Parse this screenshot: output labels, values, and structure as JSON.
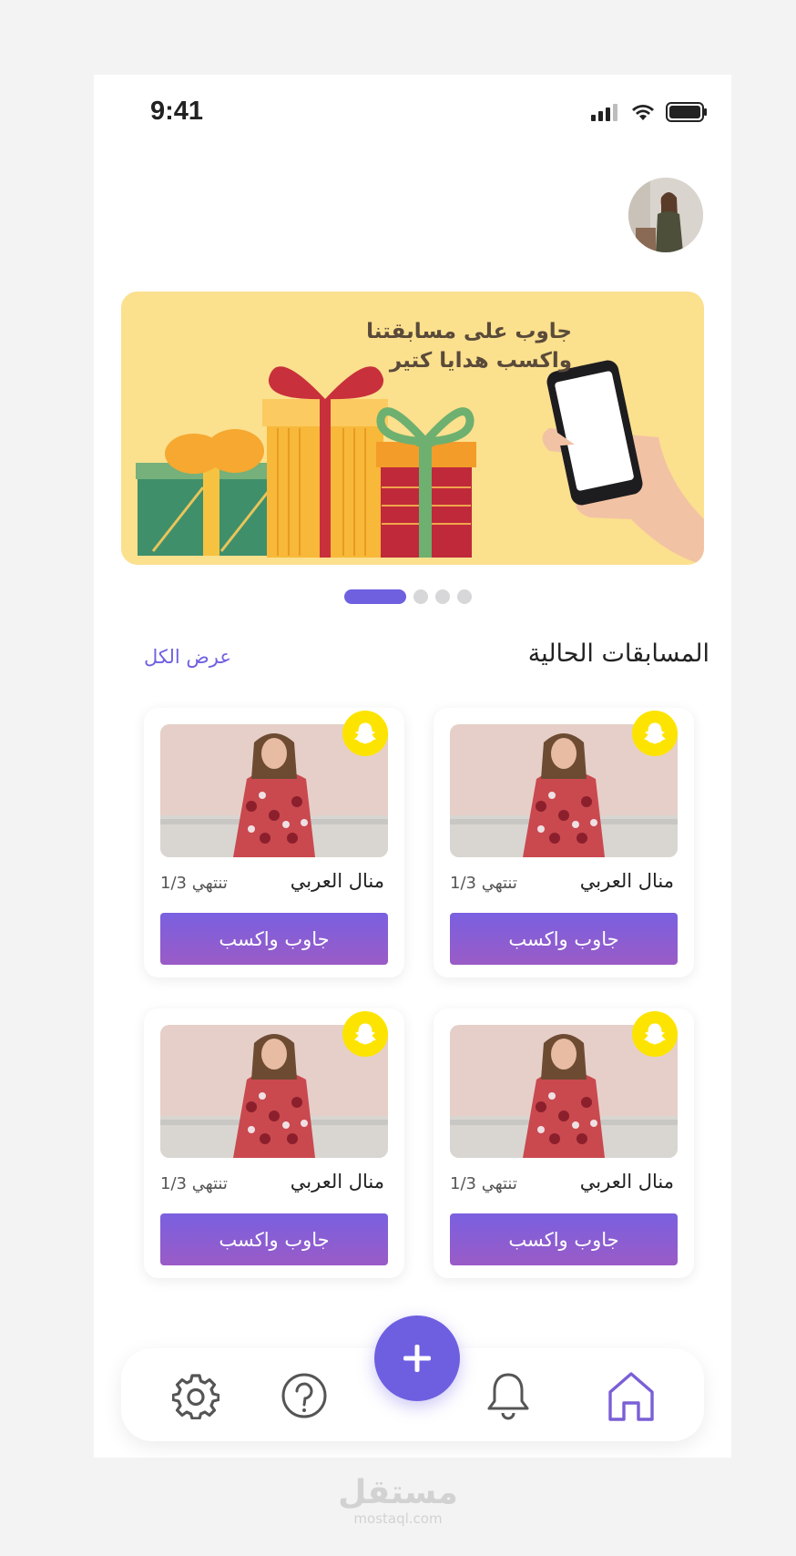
{
  "status_bar": {
    "time": "9:41"
  },
  "banner": {
    "lines": [
      "جاوب على مسابقتنا",
      "واكسب هدايا كتير"
    ]
  },
  "carousel": {
    "count": 4,
    "active": 0
  },
  "section": {
    "title": "المسابقات الحالية",
    "view_all": "عرض الكل"
  },
  "competitions": [
    {
      "name": "منال العربي",
      "ends": "تنتهي 1/3",
      "button": "جاوب واكسب"
    },
    {
      "name": "منال العربي",
      "ends": "تنتهي 1/3",
      "button": "جاوب واكسب"
    },
    {
      "name": "منال العربي",
      "ends": "تنتهي 1/3",
      "button": "جاوب واكسب"
    },
    {
      "name": "منال العربي",
      "ends": "تنتهي 1/3",
      "button": "جاوب واكسب"
    }
  ],
  "nav": {
    "items": [
      {
        "icon": "gear-icon"
      },
      {
        "icon": "help-icon"
      },
      {
        "icon": "bell-icon"
      },
      {
        "icon": "home-icon",
        "active": true
      }
    ],
    "fab_icon": "plus-icon"
  },
  "colors": {
    "accent": "#6e5fe1",
    "snap_yellow": "#fde400",
    "banner_bg": "#fbe08e"
  },
  "watermark": {
    "arabic": "مستقل",
    "latin": "mostaql.com"
  }
}
